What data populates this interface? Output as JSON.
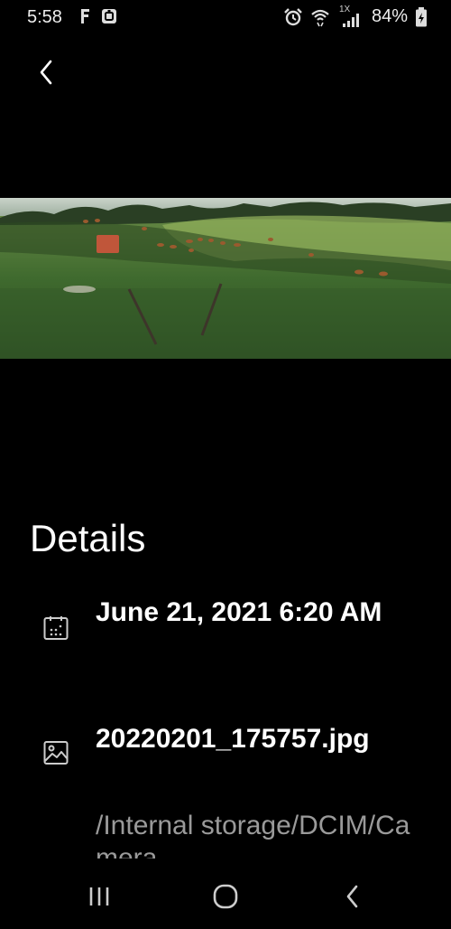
{
  "status_bar": {
    "time": "5:58",
    "left_icons": [
      "facebook-icon",
      "notification-app-icon"
    ],
    "right_icons": [
      "alarm-icon",
      "wifi-icon",
      "signal-icon",
      "battery-icon"
    ],
    "network_label": "1X",
    "battery_percent": "84%"
  },
  "toolbar": {
    "back_icon": "chevron-left-icon"
  },
  "photo": {
    "description_icon": "photo-preview"
  },
  "details": {
    "title": "Details",
    "date": {
      "icon": "calendar-icon",
      "text": "June 21, 2021 6:20 AM"
    },
    "file": {
      "icon": "image-icon",
      "name": "20220201_175757.jpg",
      "path": "/Internal storage/DCIM/Camera"
    }
  },
  "nav_bar": {
    "buttons": [
      "recents-button",
      "home-button",
      "back-button"
    ]
  },
  "colors": {
    "background": "#000000",
    "text_primary": "#ffffff",
    "text_secondary": "#9a9a9a"
  }
}
